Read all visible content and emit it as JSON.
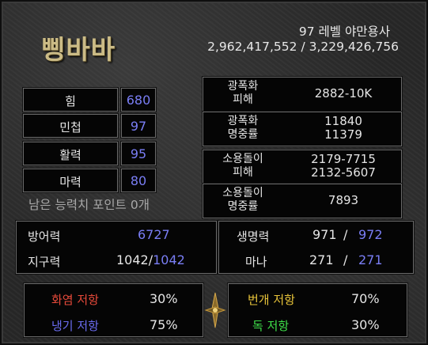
{
  "character": {
    "name": "삥바바",
    "level_class": "97 레벨 야만용사",
    "experience": "2,962,417,552 / 3,229,426,756"
  },
  "attributes": [
    {
      "label": "힘",
      "value": "680"
    },
    {
      "label": "민첩",
      "value": "97"
    },
    {
      "label": "활력",
      "value": "95"
    },
    {
      "label": "마력",
      "value": "80"
    }
  ],
  "remaining_points": "남은 능력치 포인트 0개",
  "weapons": {
    "weapon1_damage": {
      "label_line1": "광폭화",
      "label_line2": "피해",
      "value": "2882-10K"
    },
    "weapon1_ar": {
      "label_line1": "광폭화",
      "label_line2": "명중률",
      "value_line1": "11840",
      "value_line2": "11379"
    },
    "weapon2_damage": {
      "label_line1": "소용돌이",
      "label_line2": "피해",
      "value_line1": "2179-7715",
      "value_line2": "2132-5607"
    },
    "weapon2_ar": {
      "label_line1": "소용돌이",
      "label_line2": "명중률",
      "value": "7893"
    }
  },
  "defense": {
    "label": "방어력",
    "value": "6727"
  },
  "stamina": {
    "label": "지구력",
    "current": "1042",
    "max": "1042",
    "sep": "/"
  },
  "life": {
    "label": "생명력",
    "current": "971",
    "max": "972",
    "sep": "/"
  },
  "mana": {
    "label": "마나",
    "current": "271",
    "max": "271",
    "sep": "/"
  },
  "resistances": {
    "fire": {
      "label": "화염 저항",
      "value": "30%",
      "color": "#e84a3a"
    },
    "lightning": {
      "label": "번개 저항",
      "value": "70%",
      "color": "#e8c43a"
    },
    "cold": {
      "label": "냉기 저항",
      "value": "75%",
      "color": "#6a6cf0"
    },
    "poison": {
      "label": "독 저항",
      "value": "30%",
      "color": "#3ee04a"
    }
  },
  "colors": {
    "stat_blue": "#7a7ef5",
    "title_gold": "#cbbb86"
  }
}
